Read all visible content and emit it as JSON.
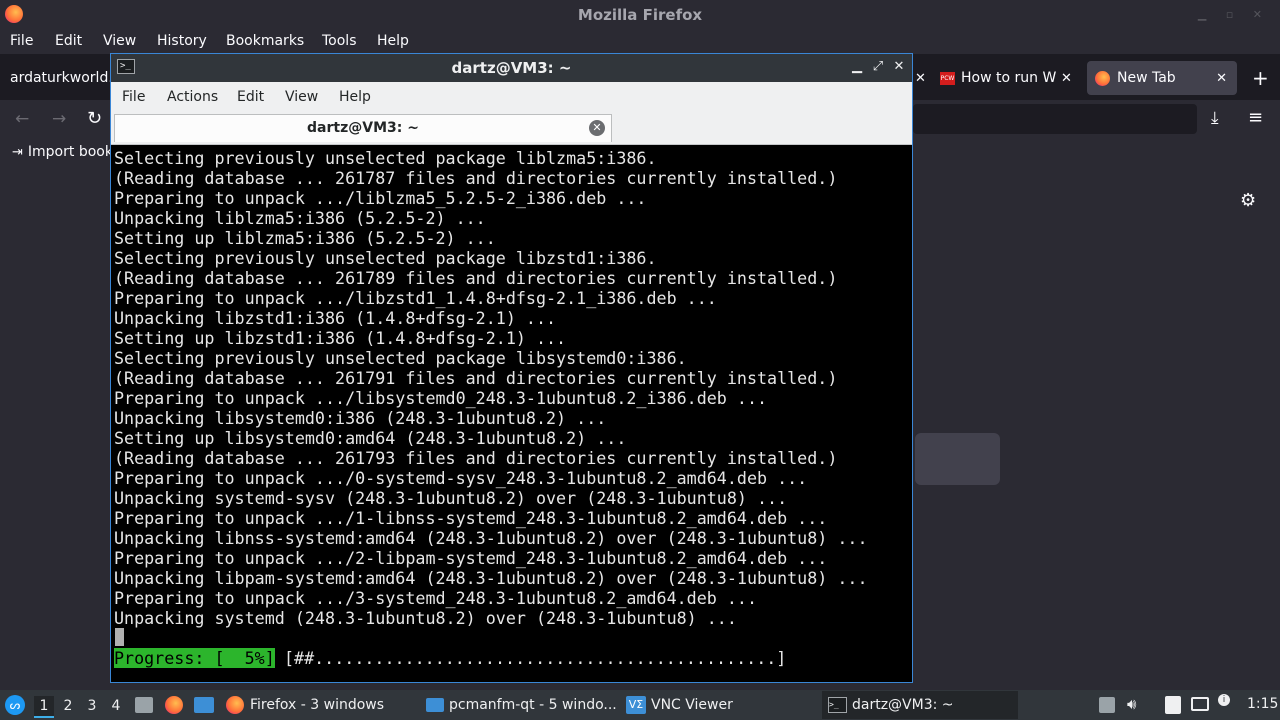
{
  "firefox": {
    "title": "Mozilla Firefox",
    "menu": [
      "File",
      "Edit",
      "View",
      "History",
      "Bookmarks",
      "Tools",
      "Help"
    ],
    "tabs": [
      {
        "label": "ardaturkworld.i"
      },
      {
        "label": "How to run Wi"
      },
      {
        "label": "New Tab"
      }
    ],
    "import_bookmarks": "Import book",
    "new_tab_plus": "+"
  },
  "terminal": {
    "title": "dartz@VM3: ~",
    "menu": [
      "File",
      "Actions",
      "Edit",
      "View",
      "Help"
    ],
    "tab_label": "dartz@VM3: ~",
    "lines": [
      "Selecting previously unselected package liblzma5:i386.",
      "(Reading database ... 261787 files and directories currently installed.)",
      "Preparing to unpack .../liblzma5_5.2.5-2_i386.deb ...",
      "Unpacking liblzma5:i386 (5.2.5-2) ...",
      "Setting up liblzma5:i386 (5.2.5-2) ...",
      "Selecting previously unselected package libzstd1:i386.",
      "(Reading database ... 261789 files and directories currently installed.)",
      "Preparing to unpack .../libzstd1_1.4.8+dfsg-2.1_i386.deb ...",
      "Unpacking libzstd1:i386 (1.4.8+dfsg-2.1) ...",
      "Setting up libzstd1:i386 (1.4.8+dfsg-2.1) ...",
      "Selecting previously unselected package libsystemd0:i386.",
      "(Reading database ... 261791 files and directories currently installed.)",
      "Preparing to unpack .../libsystemd0_248.3-1ubuntu8.2_i386.deb ...",
      "Unpacking libsystemd0:i386 (248.3-1ubuntu8.2) ...",
      "Setting up libsystemd0:amd64 (248.3-1ubuntu8.2) ...",
      "(Reading database ... 261793 files and directories currently installed.)",
      "Preparing to unpack .../0-systemd-sysv_248.3-1ubuntu8.2_amd64.deb ...",
      "Unpacking systemd-sysv (248.3-1ubuntu8.2) over (248.3-1ubuntu8) ...",
      "Preparing to unpack .../1-libnss-systemd_248.3-1ubuntu8.2_amd64.deb ...",
      "Unpacking libnss-systemd:amd64 (248.3-1ubuntu8.2) over (248.3-1ubuntu8) ...",
      "Preparing to unpack .../2-libpam-systemd_248.3-1ubuntu8.2_amd64.deb ...",
      "Unpacking libpam-systemd:amd64 (248.3-1ubuntu8.2) over (248.3-1ubuntu8) ...",
      "Preparing to unpack .../3-systemd_248.3-1ubuntu8.2_amd64.deb ...",
      "Unpacking systemd (248.3-1ubuntu8.2) over (248.3-1ubuntu8) ..."
    ],
    "progress_label": "Progress: [  5%]",
    "progress_bar": "[##..............................................]",
    "progress_fraction": 0.05
  },
  "taskbar": {
    "workspaces": [
      "1",
      "2",
      "3",
      "4"
    ],
    "tasks": [
      {
        "label": "Firefox - 3 windows"
      },
      {
        "label": "pcmanfm-qt - 5 windo..."
      },
      {
        "label": "VNC Viewer"
      },
      {
        "label": "dartz@VM3: ~"
      }
    ],
    "clock": "1:15"
  },
  "colors": {
    "terminal_border": "#3a86d6",
    "progress_green": "#2cb52c",
    "taskbar_bg": "#31363b"
  }
}
